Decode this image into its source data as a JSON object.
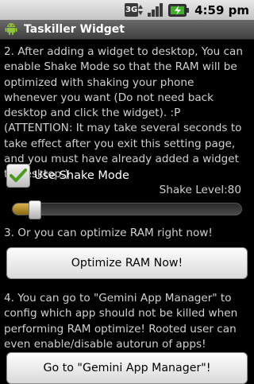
{
  "status_bar": {
    "network": "3G",
    "time": "4:59 pm",
    "icons": [
      "3g-data-icon",
      "signal-icon",
      "battery-charging-icon"
    ]
  },
  "app": {
    "title": "Taskiller Widget",
    "icon": "android-icon"
  },
  "main": {
    "para2": "2. After adding a widget to desktop, You can enable Shake Mode so that the RAM will be optimized with shaking your phone whenever you want (Do not need back desktop and click the widget). :P\n(ATTENTION: It may take several seconds to take effect after you exit this setting page, and you must have already added a widget to desktop.)",
    "shake_mode_label": "Use Shake Mode",
    "shake_mode_checked": true,
    "shake_level_label": "Shake Level:80",
    "shake_level_value": 0.1,
    "para3": "3. Or you can optimize RAM right now!",
    "optimize_button": "Optimize RAM Now!",
    "para4": "4. You can go to \"Gemini App Manager\" to config which app should not be killed when performing RAM optimize! Rooted user can even enable/disable autorun of apps!",
    "gemini_button": "Go to \"Gemini App Manager\"!"
  },
  "colors": {
    "slider_fill": "#b8922e",
    "checkmark": "#4a9a1e"
  }
}
